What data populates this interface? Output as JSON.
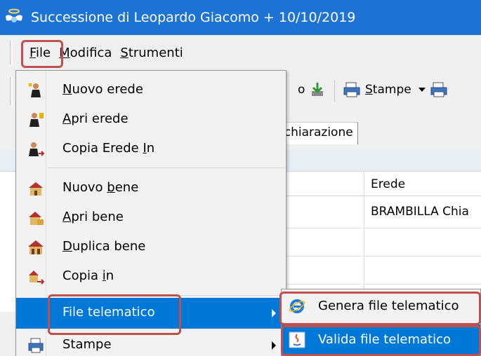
{
  "window": {
    "title": "Successione di Leopardo Giacomo + 10/10/2019"
  },
  "menubar": {
    "items": [
      {
        "label": "File",
        "accel": "F",
        "rest": "ile"
      },
      {
        "label": "Modifica",
        "accel": "M",
        "rest": "odifica"
      },
      {
        "label": "Strumenti",
        "accel": "S",
        "rest": "trumenti"
      }
    ]
  },
  "toolbar": {
    "partial_text": "o",
    "stampe_label": "Stampe",
    "stampe_accel": "S",
    "stampe_rest": "tampe"
  },
  "tabs": {
    "dichiarazione_partial": "ichiarazione"
  },
  "grid": {
    "column_header": "Erede",
    "rows": [
      "BRAMBILLA Chia"
    ]
  },
  "file_menu": {
    "items": [
      {
        "pre": "",
        "accel": "N",
        "post": "uovo erede",
        "icon": "new-heir-icon"
      },
      {
        "pre": "",
        "accel": "A",
        "post": "pri erede",
        "icon": "open-heir-icon"
      },
      {
        "pre": "Copia Erede ",
        "accel": "I",
        "post": "n",
        "icon": "copy-heir-icon"
      },
      {
        "pre": "Nuovo ",
        "accel": "b",
        "post": "ene",
        "icon": "new-asset-icon"
      },
      {
        "pre": "",
        "accel": "A",
        "post": "pri bene",
        "icon": "open-asset-icon"
      },
      {
        "pre": "",
        "accel": "D",
        "post": "uplica bene",
        "icon": "duplicate-asset-icon"
      },
      {
        "pre": "Copia ",
        "accel": "i",
        "post": "n",
        "icon": "copy-asset-icon"
      },
      {
        "pre": "File telematico",
        "accel": "",
        "post": "",
        "icon": ""
      },
      {
        "pre": "Stampe",
        "accel": "",
        "post": "",
        "icon": "printer-icon"
      }
    ]
  },
  "submenu": {
    "items": [
      {
        "label": "Genera file telematico",
        "icon": "ie-icon"
      },
      {
        "label": "Valida file telematico",
        "icon": "java-icon"
      }
    ]
  },
  "colors": {
    "titlebar": "#1e74d4",
    "highlight": "#0078d7",
    "callout": "#c0504d"
  }
}
